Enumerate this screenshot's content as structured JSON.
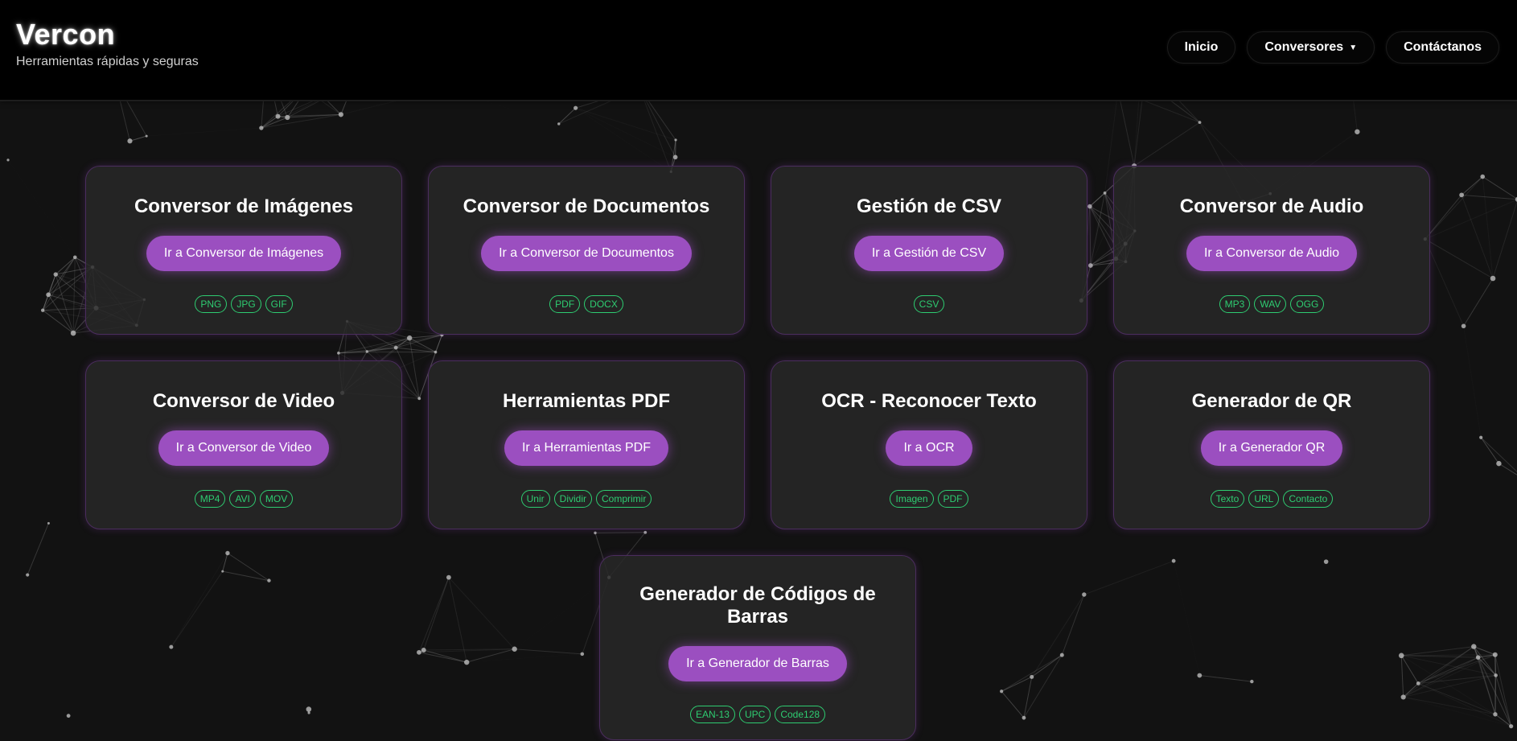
{
  "header": {
    "brand": "Vercon",
    "tagline": "Herramientas rápidas y seguras",
    "nav": [
      {
        "label": "Inicio"
      },
      {
        "label": "Conversores",
        "caret": "▼"
      },
      {
        "label": "Contáctanos"
      }
    ]
  },
  "cards": [
    {
      "title": "Conversor de Imágenes",
      "button": "Ir a Conversor de Imágenes",
      "tags": [
        "PNG",
        "JPG",
        "GIF"
      ]
    },
    {
      "title": "Conversor de Documentos",
      "button": "Ir a Conversor de Documentos",
      "tags": [
        "PDF",
        "DOCX"
      ]
    },
    {
      "title": "Gestión de CSV",
      "button": "Ir a Gestión de CSV",
      "tags": [
        "CSV"
      ]
    },
    {
      "title": "Conversor de Audio",
      "button": "Ir a Conversor de Audio",
      "tags": [
        "MP3",
        "WAV",
        "OGG"
      ]
    },
    {
      "title": "Conversor de Video",
      "button": "Ir a Conversor de Video",
      "tags": [
        "MP4",
        "AVI",
        "MOV"
      ]
    },
    {
      "title": "Herramientas PDF",
      "button": "Ir a Herramientas PDF",
      "tags": [
        "Unir",
        "Dividir",
        "Comprimir"
      ]
    },
    {
      "title": "OCR - Reconocer Texto",
      "button": "Ir a OCR",
      "tags": [
        "Imagen",
        "PDF"
      ]
    },
    {
      "title": "Generador de QR",
      "button": "Ir a Generador QR",
      "tags": [
        "Texto",
        "URL",
        "Contacto"
      ]
    },
    {
      "title": "Generador de Códigos de Barras",
      "button": "Ir a Generador de Barras",
      "tags": [
        "EAN-13",
        "UPC",
        "Code128"
      ]
    }
  ],
  "colors": {
    "background": "#121212",
    "header": "#000000",
    "accent": "#9b4fc0",
    "tag": "#2ecc71",
    "card_border": "#4b2d5e"
  }
}
